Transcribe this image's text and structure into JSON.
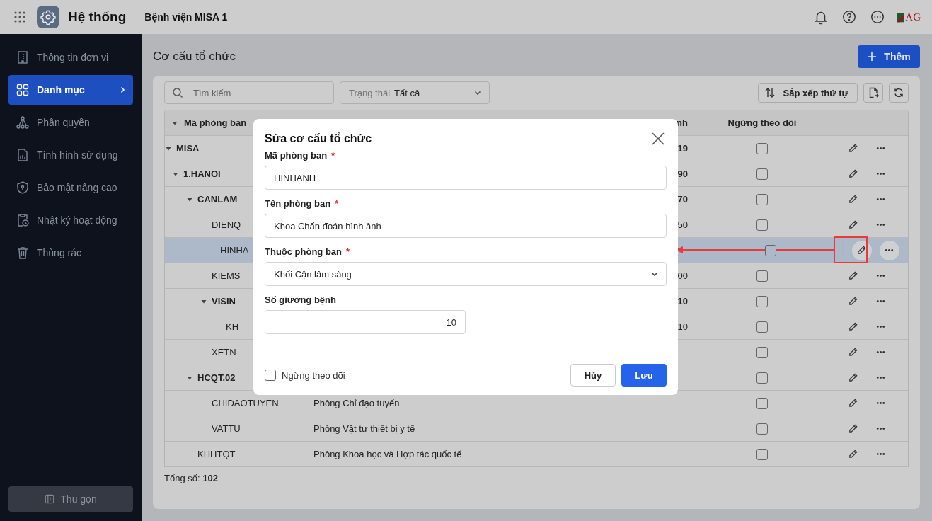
{
  "topbar": {
    "app_title": "Hệ thống",
    "org_name": "Bệnh viện MISA 1",
    "logo_text": "AG"
  },
  "sidebar": {
    "items": [
      {
        "label": "Thông tin đơn vị",
        "selected": false
      },
      {
        "label": "Danh mục",
        "selected": true
      },
      {
        "label": "Phân quyền",
        "selected": false
      },
      {
        "label": "Tình hình sử dụng",
        "selected": false
      },
      {
        "label": "Bảo mật nâng cao",
        "selected": false
      },
      {
        "label": "Nhật ký hoạt động",
        "selected": false
      },
      {
        "label": "Thùng rác",
        "selected": false
      }
    ],
    "collapse_button": "Thu gọn"
  },
  "page": {
    "title": "Cơ cấu tổ chức",
    "add_button": "Thêm"
  },
  "toolbar": {
    "search_placeholder": "Tìm kiếm",
    "status_label": "Trạng thái",
    "status_value": "Tất cả",
    "sort_button": "Sắp xếp thứ tự"
  },
  "table": {
    "columns": {
      "code": "Mã phòng ban",
      "column_3": "nh",
      "stopped": "Ngừng theo dõi"
    },
    "rows": [
      {
        "code": "MISA",
        "column_3": "19",
        "stopped": false,
        "selected": false,
        "expanded": true,
        "children": [
          {
            "code": "1.HANOI",
            "column_3": "90",
            "stopped": false,
            "selected": false,
            "expanded": true,
            "children": [
              {
                "code": "CANLAM",
                "column_3": "70",
                "stopped": false,
                "selected": false,
                "expanded": true,
                "children": [
                  {
                    "code": "DIENQ",
                    "column_3": "50",
                    "stopped": false,
                    "selected": false
                  },
                  {
                    "code": "HINHA",
                    "stopped": false,
                    "selected": true
                  },
                  {
                    "code": "KIEMS",
                    "column_3": "00",
                    "stopped": false,
                    "selected": false
                  },
                  {
                    "code": "VISIN",
                    "column_3": "10",
                    "stopped": false,
                    "selected": false,
                    "expanded": true,
                    "children": [
                      {
                        "code": "KH",
                        "column_3": "10",
                        "stopped": false,
                        "selected": false
                      }
                    ]
                  },
                  {
                    "code": "XETN",
                    "stopped": false,
                    "selected": false
                  }
                ]
              },
              {
                "code": "HCQT.02",
                "stopped": false,
                "selected": false,
                "expanded": true,
                "children": [
                  {
                    "code": "CHIDAOTUYEN",
                    "name": "Phòng Chỉ đạo tuyến",
                    "stopped": false,
                    "selected": false
                  },
                  {
                    "code": "VATTU",
                    "name": "Phòng Vật tư thiết bị y tế",
                    "stopped": false,
                    "selected": false
                  }
                ]
              },
              {
                "code": "KHHTQT",
                "name": "Phòng Khoa học và Hợp tác quốc tế",
                "stopped": false,
                "selected": false
              }
            ]
          }
        ]
      }
    ]
  },
  "footer": {
    "total_label": "Tổng số:",
    "total": "102"
  },
  "dialog": {
    "title": "Sửa cơ cấu tổ chức",
    "fields": [
      {
        "label": "Mã phòng ban",
        "required_mark": "*",
        "kind": "text",
        "value": "HINHANH"
      },
      {
        "label": "Tên phòng ban",
        "required_mark": "*",
        "kind": "text",
        "value": "Khoa Chẩn đoán hình ảnh"
      },
      {
        "label": "Thuộc phòng ban",
        "required_mark": "*",
        "kind": "select",
        "value": "Khối Cận lâm sàng"
      },
      {
        "label": "Số giường bệnh",
        "kind": "number",
        "value": "10"
      }
    ],
    "stop_checkbox": {
      "label": "Ngừng theo dõi",
      "checked": false
    },
    "cancel_button": "Hủy",
    "save_button": "Lưu"
  }
}
